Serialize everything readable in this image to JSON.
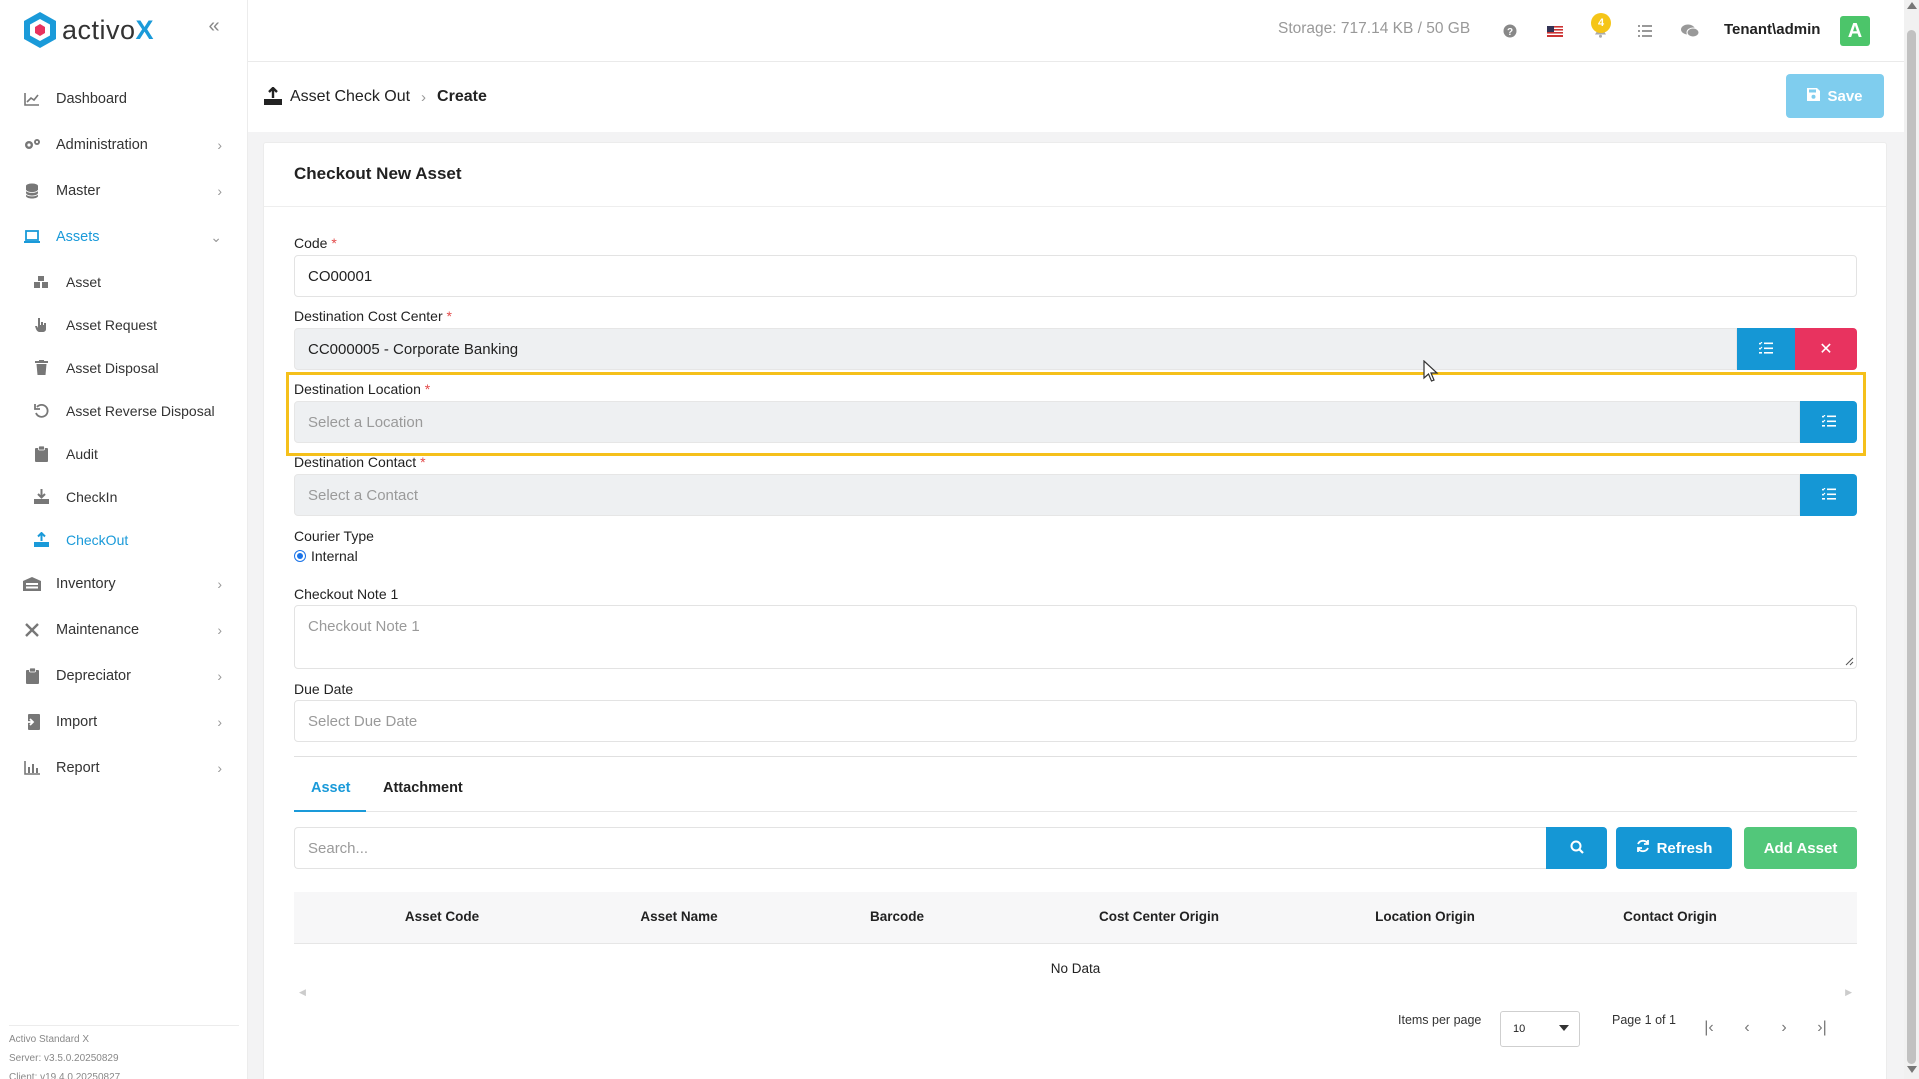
{
  "app": {
    "logo_text_main": "activo",
    "logo_text_x": "X",
    "brand_color": "#1a9ad9"
  },
  "sidebar": {
    "items": [
      {
        "label": "Dashboard",
        "icon": "chart-icon"
      },
      {
        "label": "Administration",
        "icon": "gears-icon"
      },
      {
        "label": "Master",
        "icon": "database-icon"
      },
      {
        "label": "Assets",
        "icon": "laptop-icon",
        "expanded": true
      },
      {
        "label": "Inventory",
        "icon": "warehouse-icon"
      },
      {
        "label": "Maintenance",
        "icon": "tools-icon"
      },
      {
        "label": "Depreciator",
        "icon": "clipboard-icon"
      },
      {
        "label": "Import",
        "icon": "import-icon"
      },
      {
        "label": "Report",
        "icon": "bar-chart-icon"
      }
    ],
    "sub_items": [
      {
        "label": "Asset",
        "icon": "boxes-icon"
      },
      {
        "label": "Asset Request",
        "icon": "hand-pointer-icon"
      },
      {
        "label": "Asset Disposal",
        "icon": "trash-icon"
      },
      {
        "label": "Asset Reverse Disposal",
        "icon": "undo-icon"
      },
      {
        "label": "Audit",
        "icon": "clipboard-icon"
      },
      {
        "label": "CheckIn",
        "icon": "download-icon"
      },
      {
        "label": "CheckOut",
        "icon": "upload-icon",
        "active": true
      }
    ],
    "version": {
      "edition": "Activo Standard X",
      "server": "Server: v3.5.0.20250829",
      "client": "Client: v19.4.0.20250827"
    }
  },
  "topbar": {
    "storage": "Storage: 717.14 KB / 50 GB",
    "notification_count": "4",
    "user": "Tenant\\admin",
    "avatar_letter": "A"
  },
  "header": {
    "breadcrumb_parent": "Asset Check Out",
    "breadcrumb_current": "Create",
    "save_label": "Save"
  },
  "form": {
    "title": "Checkout New Asset",
    "code": {
      "label": "Code",
      "value": "CO00001"
    },
    "cost_center": {
      "label": "Destination Cost Center",
      "value": "CC000005 - Corporate Banking"
    },
    "location": {
      "label": "Destination Location",
      "placeholder": "Select a Location"
    },
    "contact": {
      "label": "Destination Contact",
      "placeholder": "Select a Contact"
    },
    "courier": {
      "label": "Courier Type",
      "option": "Internal"
    },
    "note": {
      "label": "Checkout Note 1",
      "placeholder": "Checkout Note 1"
    },
    "due_date": {
      "label": "Due Date",
      "placeholder": "Select Due Date"
    },
    "required_mark": "*"
  },
  "tabs": [
    "Asset",
    "Attachment"
  ],
  "asset_table": {
    "search_placeholder": "Search...",
    "refresh_label": "Refresh",
    "add_label": "Add Asset",
    "columns": [
      "Asset Code",
      "Asset Name",
      "Barcode",
      "Cost Center Origin",
      "Location Origin",
      "Contact Origin"
    ],
    "empty_text": "No Data",
    "items_per_page_label": "Items per page",
    "items_per_page": "10",
    "page_info": "Page 1 of 1"
  }
}
